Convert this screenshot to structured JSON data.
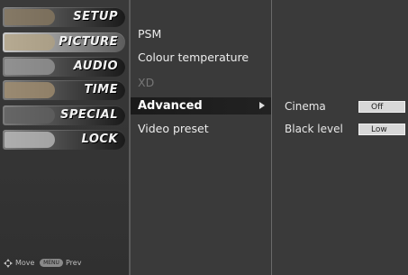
{
  "sidebar": {
    "categories": [
      {
        "label": "SETUP",
        "active": false,
        "thumb_color": "#8a7a60"
      },
      {
        "label": "PICTURE",
        "active": true,
        "thumb_color": "#b0a080"
      },
      {
        "label": "AUDIO",
        "active": false,
        "thumb_color": "#9a9a9a"
      },
      {
        "label": "TIME",
        "active": false,
        "thumb_color": "#a59070"
      },
      {
        "label": "SPECIAL",
        "active": false,
        "thumb_color": "#606060"
      },
      {
        "label": "LOCK",
        "active": false,
        "thumb_color": "#c0c0c0"
      }
    ],
    "footer": {
      "move_label": "Move",
      "menu_key": "MENU",
      "prev_label": "Prev"
    }
  },
  "options": {
    "items": [
      {
        "label": "PSM",
        "disabled": false
      },
      {
        "label": "Colour temperature",
        "disabled": false
      },
      {
        "label": "XD",
        "disabled": true
      },
      {
        "label": "Advanced",
        "selected": true
      },
      {
        "label": "Video preset",
        "disabled": false
      }
    ]
  },
  "subpanel": {
    "rows": [
      {
        "name": "Cinema",
        "value": "Off"
      },
      {
        "name": "Black level",
        "value": "Low"
      }
    ]
  }
}
